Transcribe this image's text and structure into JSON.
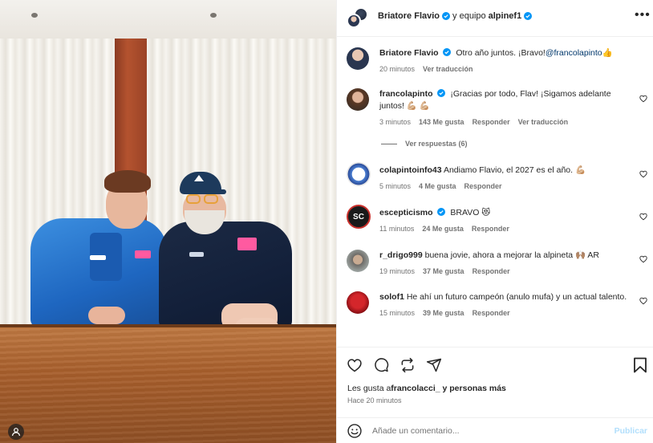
{
  "header": {
    "author": "Briatore Flavio",
    "joiner": "y equipo",
    "collaborator": "alpinef1"
  },
  "comments": [
    {
      "username": "Briatore Flavio",
      "text": "Otro año juntos. ¡Bravo!",
      "mention": "@francolapinto",
      "emoji": "👍",
      "time": "20 minutos",
      "translate": "Ver traducción",
      "verified": true
    },
    {
      "username": "francolapinto",
      "text": "¡Gracias por todo, Flav! ¡Sigamos adelante juntos! 💪🏼 💪🏼",
      "time": "3 minutos",
      "likes": "143 Me gusta",
      "reply": "Responder",
      "translate": "Ver traducción",
      "view_replies": "Ver respuestas (6)",
      "verified": true
    },
    {
      "username": "colapintoinfo43",
      "text": "Andiamo Flavio, el 2027 es el año. 💪🏼",
      "time": "5 minutos",
      "likes": "4 Me gusta",
      "reply": "Responder"
    },
    {
      "username": "escepticismo",
      "text": "BRAVO 😻",
      "time": "11 minutos",
      "likes": "24 Me gusta",
      "reply": "Responder",
      "avatar_text": "SC",
      "verified": true
    },
    {
      "username": "r_drigo999",
      "text": "buena jovie, ahora a mejorar la alpineta 🙌🏽 AR",
      "time": "19 minutos",
      "likes": "37 Me gusta",
      "reply": "Responder"
    },
    {
      "username": "solof1",
      "text": "He ahí un futuro campeón (anulo mufa) y un actual talento.",
      "time": "15 minutos",
      "likes": "39 Me gusta",
      "reply": "Responder"
    }
  ],
  "likes_line": {
    "prefix": "Les gusta a",
    "user": "francolacci_",
    "suffix": "y personas más"
  },
  "posted_ago": "Hace 20 minutos",
  "comment_box": {
    "placeholder": "Añade un comentario...",
    "publish": "Publicar"
  },
  "icons": {
    "like": "heart-icon",
    "comment": "comment-icon",
    "repost": "repost-icon",
    "share": "share-icon",
    "save": "bookmark-icon",
    "emoji": "emoji-icon",
    "more": "more-icon"
  },
  "colors": {
    "verified": "#0095f6",
    "link": "#00376b",
    "publish_disabled": "#b2dffc",
    "alpine_blue": "#1e6fc9"
  }
}
